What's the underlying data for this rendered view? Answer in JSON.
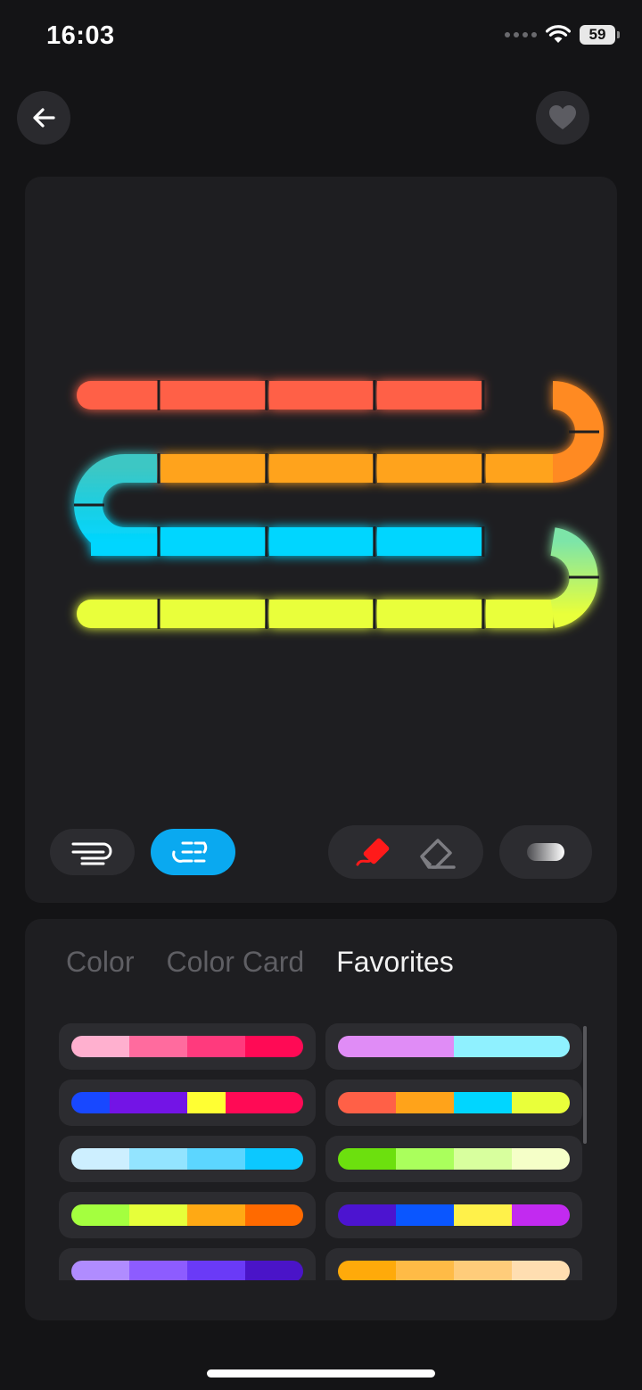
{
  "status_bar": {
    "time": "16:03",
    "battery": "59"
  },
  "header": {
    "back_icon": "arrow-left-icon",
    "favorite_icon": "heart-icon"
  },
  "strip_preview": {
    "rows": [
      {
        "color": "#ff6047"
      },
      {
        "color": "#ffa31a"
      },
      {
        "color": "#00d6ff"
      },
      {
        "color": "#e9ff3a"
      }
    ]
  },
  "tools": {
    "continuous_mode_icon": "continuous-strip-icon",
    "segment_mode_icon": "segmented-strip-icon",
    "brush_icon": "brush-icon",
    "eraser_icon": "eraser-icon",
    "gradient_icon": "gradient-toggle-icon",
    "accent_color": "#0aa9f0"
  },
  "palette_tabs": [
    {
      "label": "Color",
      "active": false
    },
    {
      "label": "Color Card",
      "active": false
    },
    {
      "label": "Favorites",
      "active": true
    }
  ],
  "favorites": [
    {
      "colors": [
        "#ffb0cf",
        "#ff6b9e",
        "#ff3a7d",
        "#ff0a55"
      ]
    },
    {
      "colors": [
        "#e08cf6",
        "#8ff1ff"
      ]
    },
    {
      "colors": [
        "#1848ff",
        "#7314e6",
        "#7314e6",
        "#ffff33",
        "#ff0a55",
        "#ff0a55"
      ]
    },
    {
      "colors": [
        "#ff6047",
        "#ffa31a",
        "#00d6ff",
        "#e9ff3a"
      ]
    },
    {
      "colors": [
        "#cdefff",
        "#93e4ff",
        "#5cd6ff",
        "#0cc8ff"
      ]
    },
    {
      "colors": [
        "#6ce00e",
        "#aaff5c",
        "#d8ff9e",
        "#f5ffc8"
      ]
    },
    {
      "colors": [
        "#a4ff3f",
        "#e6ff3a",
        "#ffa914",
        "#ff6a00"
      ]
    },
    {
      "colors": [
        "#4c14d0",
        "#0a56ff",
        "#fff14a",
        "#c22af0"
      ]
    },
    {
      "colors": [
        "#b08cff",
        "#8d5cff",
        "#6a3af7",
        "#4a14c8"
      ]
    },
    {
      "colors": [
        "#ffaa0a",
        "#ffbb46",
        "#ffcc7a",
        "#ffdeb1"
      ]
    }
  ]
}
